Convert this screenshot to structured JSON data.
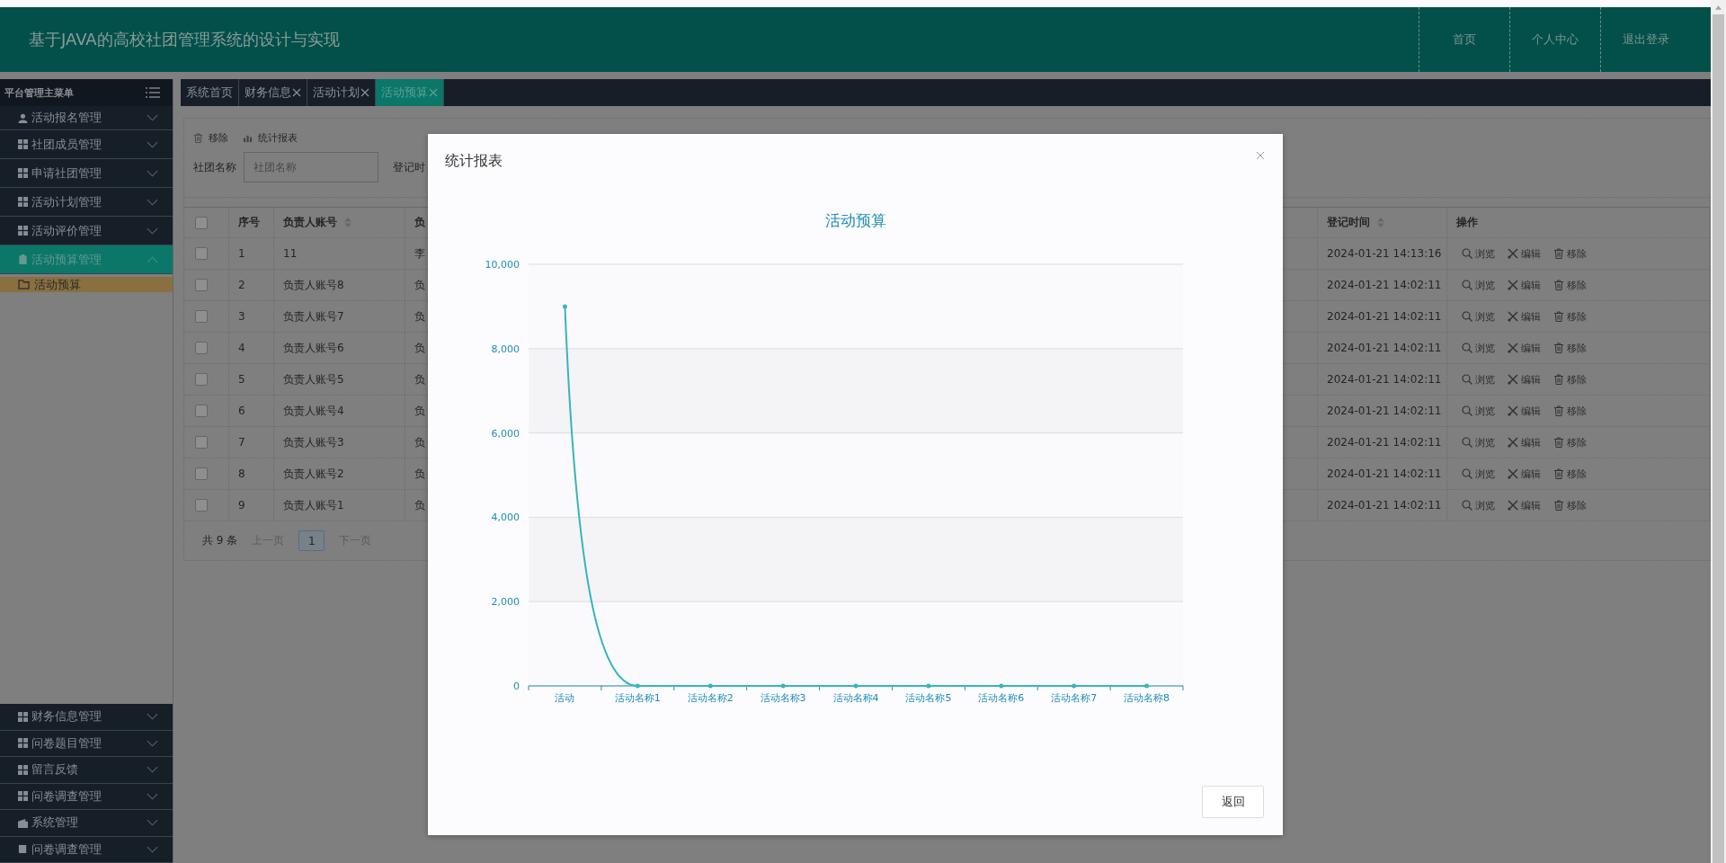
{
  "header": {
    "title": "基于JAVA的高校社团管理系统的设计与实现",
    "nav": [
      "首页",
      "个人中心",
      "退出登录"
    ]
  },
  "sidebar": {
    "title": "平台管理主菜单",
    "items": [
      {
        "label": "活动报名管理",
        "expanded": false,
        "selected": false
      },
      {
        "label": "社团成员管理",
        "expanded": false,
        "selected": false
      },
      {
        "label": "申请社团管理",
        "expanded": false,
        "selected": false
      },
      {
        "label": "活动计划管理",
        "expanded": false,
        "selected": false
      },
      {
        "label": "活动评价管理",
        "expanded": false,
        "selected": false
      },
      {
        "label": "活动预算管理",
        "expanded": true,
        "selected": true,
        "children": [
          {
            "label": "活动预算",
            "selected": true
          }
        ]
      }
    ],
    "bottom_items": [
      {
        "label": "财务信息管理",
        "expanded": false,
        "selected": false
      },
      {
        "label": "问卷题目管理",
        "expanded": false,
        "selected": false
      },
      {
        "label": "留言反馈",
        "expanded": false,
        "selected": false
      },
      {
        "label": "问卷调查管理",
        "expanded": false,
        "selected": false
      },
      {
        "label": "系统管理",
        "expanded": false,
        "selected": false
      },
      {
        "label": "问卷调查管理",
        "expanded": false,
        "selected": false
      }
    ]
  },
  "tabs": [
    {
      "label": "系统首页",
      "closable": false,
      "selected": false
    },
    {
      "label": "财务信息",
      "closable": true,
      "selected": false
    },
    {
      "label": "活动计划",
      "closable": true,
      "selected": false
    },
    {
      "label": "活动预算",
      "closable": true,
      "selected": true
    }
  ],
  "toolbar": [
    "移除",
    "统计报表"
  ],
  "search": {
    "label": "社团名称",
    "placeholder": "社团名称",
    "next_label": "登记时"
  },
  "table": {
    "all_checked": false,
    "columns": [
      {
        "label": "序号",
        "sortable": false
      },
      {
        "label": "负责人账号",
        "sortable": true
      },
      {
        "label": "负"
      },
      {
        "label": "登记时间",
        "sortable": true
      },
      {
        "label": "操作",
        "sortable": false
      }
    ],
    "rows": [
      {
        "checked": false,
        "cells": [
          "1",
          "11",
          "李",
          "2024-01-21 14:13:16"
        ],
        "actions": [
          "浏览",
          "编辑",
          "移除"
        ]
      },
      {
        "checked": false,
        "cells": [
          "2",
          "负责人账号8",
          "负",
          "2024-01-21 14:02:11"
        ],
        "actions": [
          "浏览",
          "编辑",
          "移除"
        ]
      },
      {
        "checked": false,
        "cells": [
          "3",
          "负责人账号7",
          "负",
          "2024-01-21 14:02:11"
        ],
        "actions": [
          "浏览",
          "编辑",
          "移除"
        ]
      },
      {
        "checked": false,
        "cells": [
          "4",
          "负责人账号6",
          "负",
          "2024-01-21 14:02:11"
        ],
        "actions": [
          "浏览",
          "编辑",
          "移除"
        ]
      },
      {
        "checked": false,
        "cells": [
          "5",
          "负责人账号5",
          "负",
          "2024-01-21 14:02:11"
        ],
        "actions": [
          "浏览",
          "编辑",
          "移除"
        ]
      },
      {
        "checked": false,
        "cells": [
          "6",
          "负责人账号4",
          "负",
          "2024-01-21 14:02:11"
        ],
        "actions": [
          "浏览",
          "编辑",
          "移除"
        ]
      },
      {
        "checked": false,
        "cells": [
          "7",
          "负责人账号3",
          "负",
          "2024-01-21 14:02:11"
        ],
        "actions": [
          "浏览",
          "编辑",
          "移除"
        ]
      },
      {
        "checked": false,
        "cells": [
          "8",
          "负责人账号2",
          "负",
          "2024-01-21 14:02:11"
        ],
        "actions": [
          "浏览",
          "编辑",
          "移除"
        ]
      },
      {
        "checked": false,
        "cells": [
          "9",
          "负责人账号1",
          "负",
          "2024-01-21 14:02:11"
        ],
        "actions": [
          "浏览",
          "编辑",
          "移除"
        ]
      }
    ]
  },
  "pagination": {
    "total": "共 9 条",
    "prev": "上一页",
    "pages": [
      {
        "label": "1",
        "selected": true
      }
    ],
    "next": "下一页"
  },
  "modal": {
    "title": "统计报表",
    "button": "返回",
    "chart_data": {
      "type": "line",
      "title": "活动预算",
      "categories": [
        "活动",
        "活动名称1",
        "活动名称2",
        "活动名称3",
        "活动名称4",
        "活动名称5",
        "活动名称6",
        "活动名称7",
        "活动名称8"
      ],
      "values": [
        9000,
        0,
        0,
        0,
        0,
        0,
        0,
        0,
        0
      ],
      "ylim": [
        0,
        10000
      ],
      "grid": true,
      "yticks": [
        {
          "value": 0,
          "label": "0"
        },
        {
          "value": 2000,
          "label": "2,000"
        },
        {
          "value": 4000,
          "label": "4,000"
        },
        {
          "value": 6000,
          "label": "6,000"
        },
        {
          "value": 8000,
          "label": "8,000"
        },
        {
          "value": 10000,
          "label": "10,000"
        }
      ]
    }
  }
}
